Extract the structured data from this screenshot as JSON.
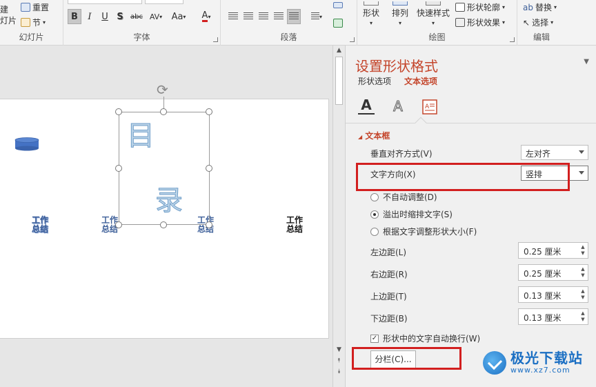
{
  "ribbon": {
    "new_slide_top": "建",
    "new_slide_bottom": "灯片",
    "reset": "重置",
    "section": "节",
    "slides_group": "幻灯片",
    "font_group": "字体",
    "paragraph_group": "段落",
    "drawing_group": "绘图",
    "editing_group": "编辑",
    "bold": "B",
    "italic": "I",
    "underline": "U",
    "shadow": "S",
    "strikethrough": "abc",
    "spacing": "AV",
    "case": "Aa",
    "font_color": "A",
    "shape_label": "形状",
    "arrange_label": "排列",
    "quick_styles_label": "快速样式",
    "shape_outline": "形状轮廓",
    "shape_effects": "形状效果",
    "replace": "替换",
    "select": "选择"
  },
  "slide": {
    "glyph_top": "目",
    "glyph_bottom": "录",
    "items": [
      {
        "line1": "工作",
        "line2": "总结"
      },
      {
        "line1": "工作",
        "line2": "总结"
      },
      {
        "line1": "工作",
        "line2": "总结"
      },
      {
        "line1": "工作",
        "line2": "总结"
      }
    ]
  },
  "pane": {
    "title": "设置形状格式",
    "tab_shape": "形状选项",
    "tab_text": "文本选项",
    "section": "文本框",
    "valign_label": "垂直对齐方式(V)",
    "valign_value": "左对齐",
    "direction_label": "文字方向(X)",
    "direction_value": "竖排",
    "radio_no_autofit": "不自动调整(D)",
    "radio_shrink": "溢出时缩排文字(S)",
    "radio_resize": "根据文字调整形状大小(F)",
    "left_margin_label": "左边距(L)",
    "left_margin_value": "0.25 厘米",
    "right_margin_label": "右边距(R)",
    "right_margin_value": "0.25 厘米",
    "top_margin_label": "上边距(T)",
    "top_margin_value": "0.13 厘米",
    "bottom_margin_label": "下边距(B)",
    "bottom_margin_value": "0.13 厘米",
    "wrap_label": "形状中的文字自动换行(W)",
    "columns_button": "分栏(C)..."
  },
  "watermark": {
    "title": "极光下载站",
    "url": "www.xz7.com"
  },
  "colors": {
    "accent": "#c4452b",
    "highlight": "#d21f1f",
    "shape_blue": "#4472c4"
  }
}
